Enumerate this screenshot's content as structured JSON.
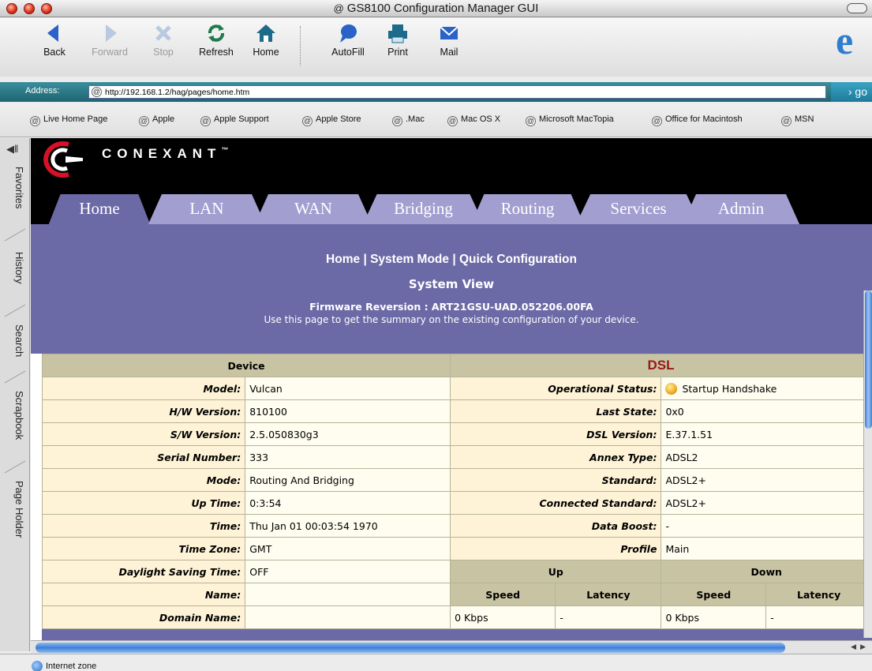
{
  "window": {
    "title": "GS8100 Configuration Manager GUI",
    "title_icon": "at-icon"
  },
  "toolbar": {
    "buttons": [
      {
        "label": "Back",
        "icon": "back-arrow-icon"
      },
      {
        "label": "Forward",
        "icon": "forward-arrow-icon"
      },
      {
        "label": "Stop",
        "icon": "stop-x-icon"
      },
      {
        "label": "Refresh",
        "icon": "refresh-icon"
      },
      {
        "label": "Home",
        "icon": "home-icon"
      },
      {
        "label": "AutoFill",
        "icon": "autofill-icon"
      },
      {
        "label": "Print",
        "icon": "printer-icon"
      },
      {
        "label": "Mail",
        "icon": "mail-icon"
      }
    ]
  },
  "address": {
    "label": "Address:",
    "url": "http://192.168.1.2/hag/pages/home.htm",
    "go_label": "› go"
  },
  "favorites": [
    "Live Home Page",
    "Apple",
    "Apple Support",
    "Apple Store",
    ".Mac",
    "Mac OS X",
    "Microsoft MacTopia",
    "Office for Macintosh",
    "MSN"
  ],
  "side_tabs": [
    "Favorites",
    "History",
    "Search",
    "Scrapbook",
    "Page Holder"
  ],
  "brand": {
    "name": "CONEXANT",
    "mark": "™"
  },
  "nav_tabs": [
    "Home",
    "LAN",
    "WAN",
    "Bridging",
    "Routing",
    "Services",
    "Admin"
  ],
  "header": {
    "crumbs": [
      "Home",
      "System Mode",
      "Quick Configuration"
    ],
    "crumb_sep": "|",
    "view_title": "System View",
    "firmware": "Firmware Reversion : ART21GSU-UAD.052206.00FA",
    "description": "Use this page to get the summary on the existing configuration of your device."
  },
  "device_table": {
    "header": "Device",
    "rows": [
      {
        "label": "Model:",
        "value": "Vulcan"
      },
      {
        "label": "H/W Version:",
        "value": "810100"
      },
      {
        "label": "S/W Version:",
        "value": "2.5.050830g3"
      },
      {
        "label": "Serial Number:",
        "value": "333"
      },
      {
        "label": "Mode:",
        "value": "Routing And Bridging"
      },
      {
        "label": "Up Time:",
        "value": "0:3:54"
      },
      {
        "label": "Time:",
        "value": "Thu Jan 01 00:03:54 1970"
      },
      {
        "label": "Time Zone:",
        "value": "GMT"
      },
      {
        "label": "Daylight Saving Time:",
        "value": "OFF"
      },
      {
        "label": "Name:",
        "value": ""
      },
      {
        "label": "Domain Name:",
        "value": ""
      }
    ]
  },
  "dsl_table": {
    "header": "DSL",
    "rows": [
      {
        "label": "Operational Status:",
        "value": "Startup Handshake"
      },
      {
        "label": "Last State:",
        "value": "0x0"
      },
      {
        "label": "DSL Version:",
        "value": "E.37.1.51"
      },
      {
        "label": "Annex Type:",
        "value": "ADSL2"
      },
      {
        "label": "Standard:",
        "value": "ADSL2+"
      },
      {
        "label": "Connected Standard:",
        "value": "ADSL2+"
      },
      {
        "label": "Data Boost:",
        "value": "-"
      },
      {
        "label": "Profile",
        "value": "Main"
      }
    ],
    "up_label": "Up",
    "down_label": "Down",
    "speed_label": "Speed",
    "latency_label": "Latency",
    "up_speed": "0 Kbps",
    "up_latency": "-",
    "down_speed": "0 Kbps",
    "down_latency": "-"
  },
  "status": {
    "zone": "Internet zone"
  },
  "colors": {
    "panel": "#6c6aa6",
    "tab": "#a39ed0",
    "dsl_header": "#991818",
    "address_bar": "#2a7a88"
  }
}
